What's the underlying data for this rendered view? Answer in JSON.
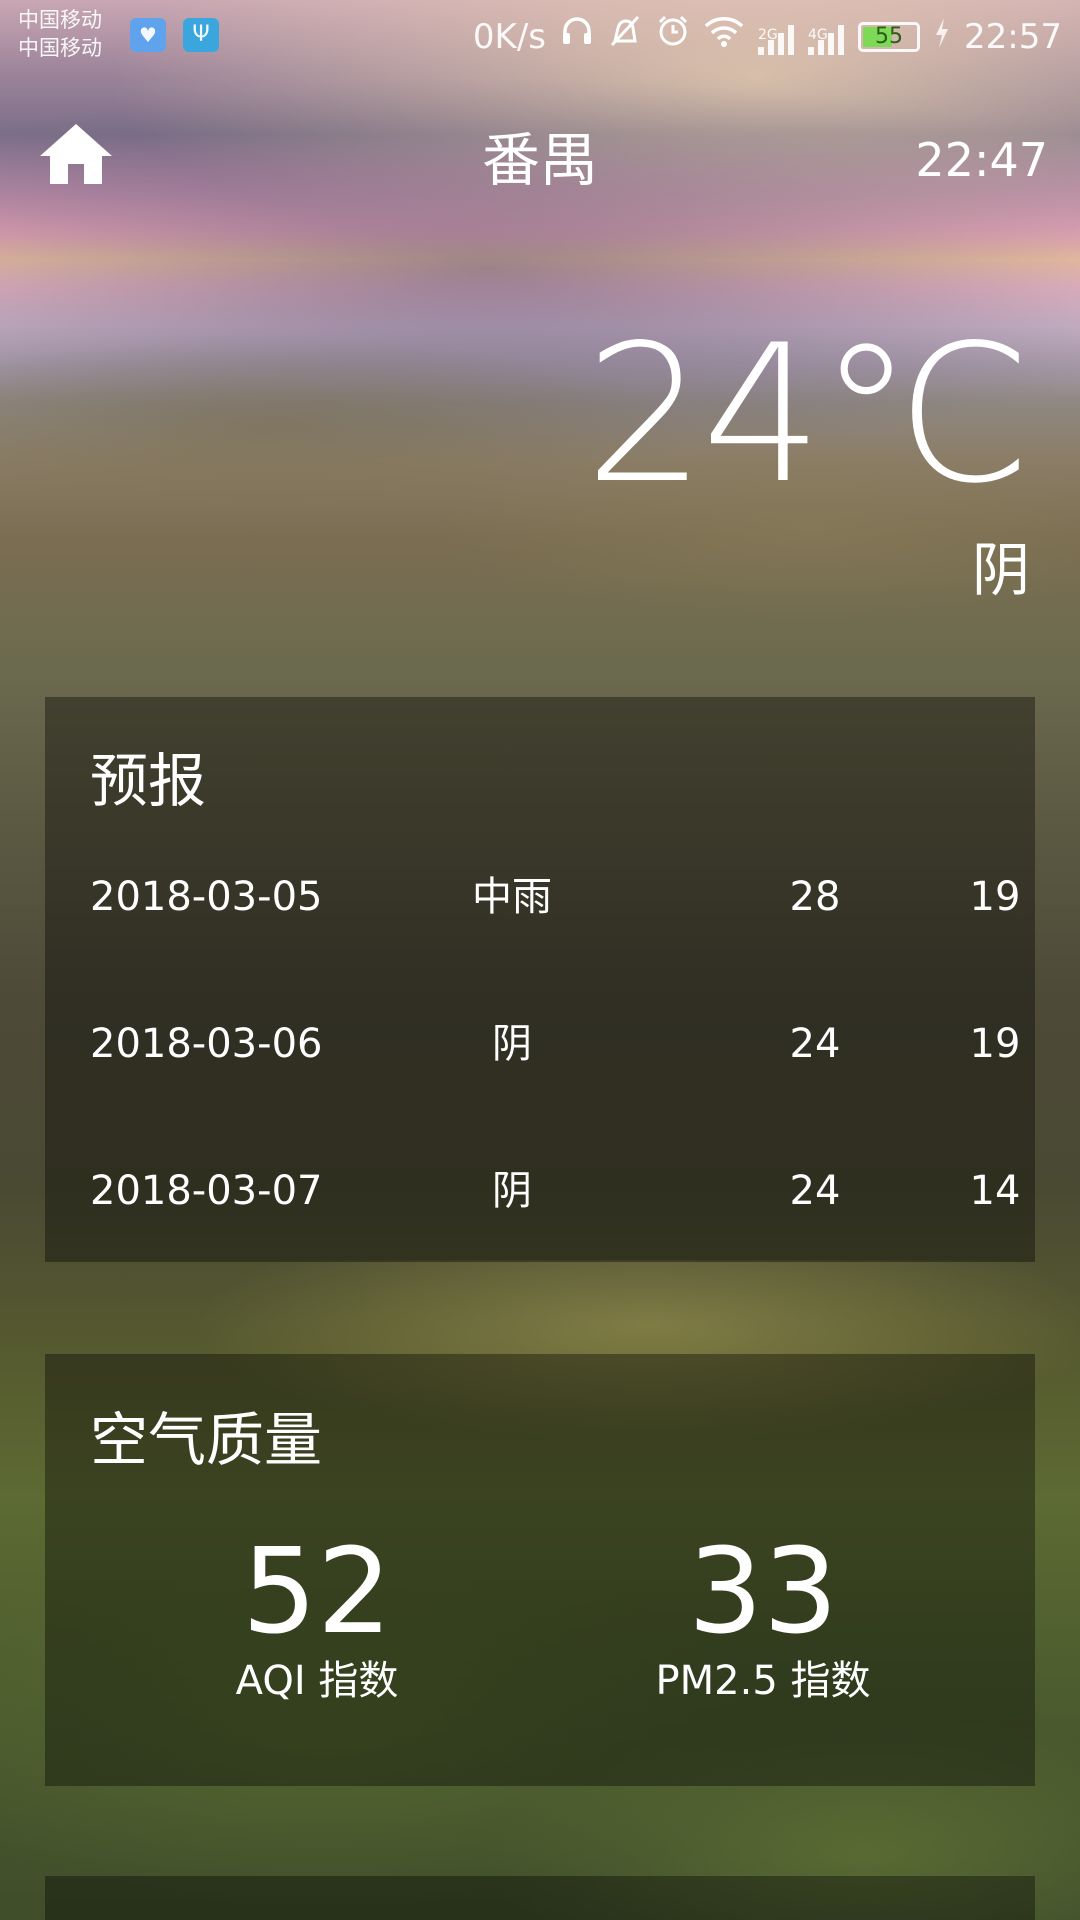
{
  "status_bar": {
    "carrier_1": "中国移动",
    "carrier_2": "中国移动",
    "net_speed": "0K/s",
    "signal_1_tag": "2G",
    "signal_2_tag": "4G",
    "battery_level": "55",
    "battery_fraction": 0.55,
    "clock": "22:57",
    "icons": [
      "health-icon",
      "usb-icon",
      "headphones-icon",
      "mute-icon",
      "alarm-icon",
      "wifi-icon",
      "signal-icon",
      "signal-icon",
      "battery-icon",
      "charging-icon"
    ]
  },
  "header": {
    "city": "番禺",
    "update_time": "22:47",
    "home_icon": "home-icon"
  },
  "now": {
    "temperature": "24℃",
    "condition": "阴"
  },
  "forecast": {
    "title": "预报",
    "rows": [
      {
        "date": "2018-03-05",
        "condition": "中雨",
        "max": "28",
        "min": "19"
      },
      {
        "date": "2018-03-06",
        "condition": "阴",
        "max": "24",
        "min": "19"
      },
      {
        "date": "2018-03-07",
        "condition": "阴",
        "max": "24",
        "min": "14"
      }
    ]
  },
  "aqi": {
    "title": "空气质量",
    "aqi_value": "52",
    "aqi_label": "AQI 指数",
    "pm25_value": "33",
    "pm25_label": "PM2.5 指数"
  }
}
